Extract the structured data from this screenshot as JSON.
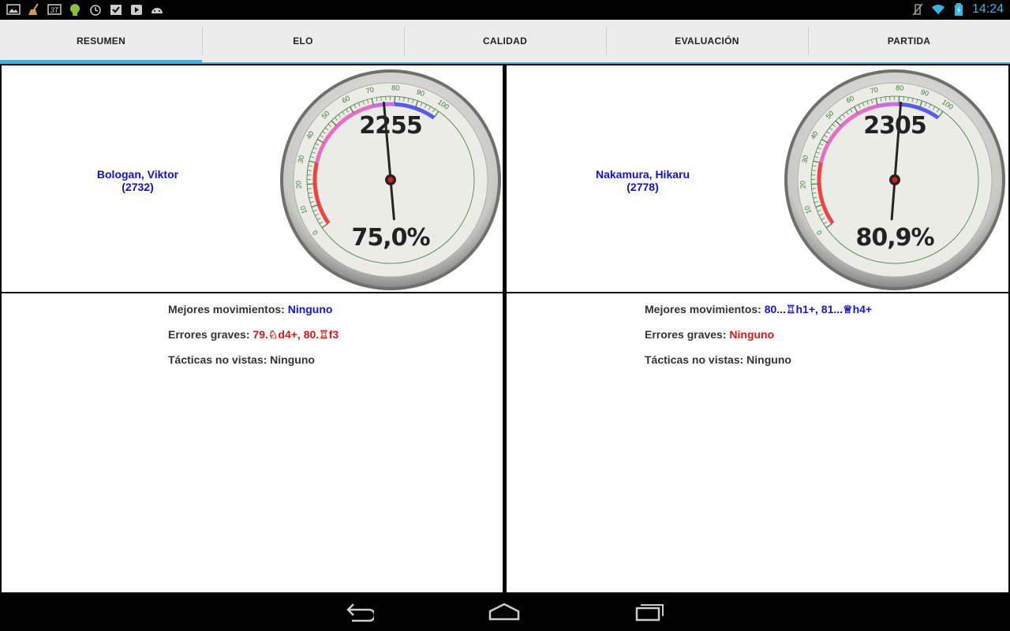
{
  "status": {
    "time": "14:24",
    "left_icons": [
      "gallery-icon",
      "broom-icon",
      "three-g-icon",
      "android-icon",
      "alarm-icon",
      "task-check-icon",
      "play-store-icon",
      "android-head-icon"
    ],
    "right_icons": [
      "no-vibrate-icon",
      "wifi-icon",
      "battery-charging-icon"
    ]
  },
  "tabs": [
    {
      "label": "RESUMEN",
      "active": true
    },
    {
      "label": "ELO",
      "active": false
    },
    {
      "label": "CALIDAD",
      "active": false
    },
    {
      "label": "EVALUACIÓN",
      "active": false
    },
    {
      "label": "PARTIDA",
      "active": false
    }
  ],
  "players": [
    {
      "name": "Bologan, Viktor",
      "rating": "(2732)",
      "gauge_elo": "2255",
      "gauge_percent": "75,0%",
      "gauge_needle_value": 75.0,
      "stats": {
        "best_label": "Mejores movimientos: ",
        "best_value": "Ninguno",
        "errors_label": "Errores graves: ",
        "errors_value": "79.♘d4+, 80.♖f3",
        "tactics_label": "Tácticas no vistas: ",
        "tactics_value": "Ninguno"
      }
    },
    {
      "name": "Nakamura, Hikaru",
      "rating": "(2778)",
      "gauge_elo": "2305",
      "gauge_percent": "80,9%",
      "gauge_needle_value": 80.9,
      "stats": {
        "best_label": "Mejores movimientos: ",
        "best_value": "80...♖h1+, 81...♕h4+",
        "errors_label": "Errores graves: ",
        "errors_value": "Ninguno",
        "tactics_label": "Tácticas no vistas: ",
        "tactics_value": "Ninguno"
      }
    }
  ],
  "gauge_scale": {
    "ticks": [
      "0",
      "10",
      "20",
      "30",
      "40",
      "50",
      "60",
      "70",
      "80",
      "90",
      "100"
    ],
    "min": 0,
    "max": 100
  },
  "colors": {
    "accent": "#33b5e5",
    "player_name": "#1010d0",
    "best_moves": "#1515e0",
    "errors": "#e01515",
    "gauge_needle_hub": "#d42020"
  }
}
